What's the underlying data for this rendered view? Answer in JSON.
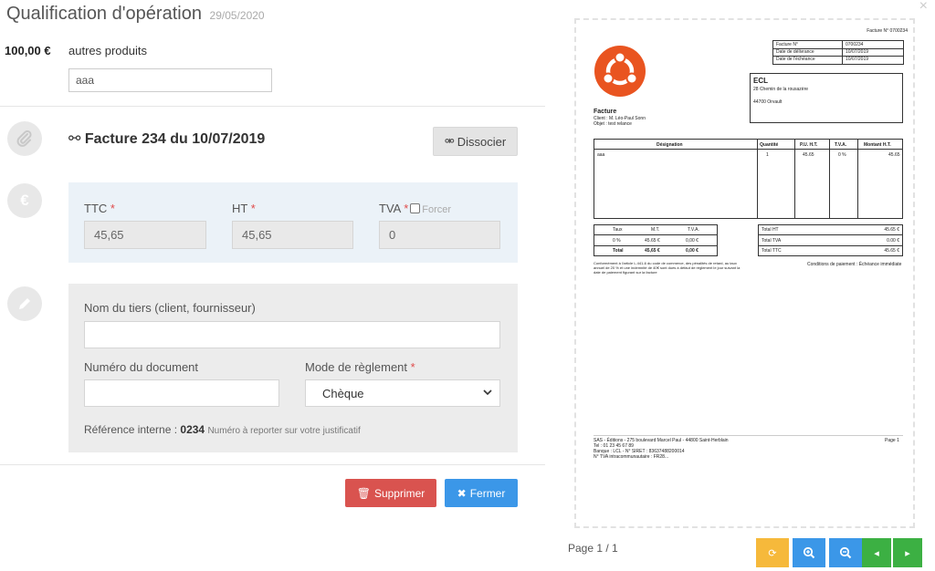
{
  "modal": {
    "title": "Qualification d'opération",
    "date": "29/05/2020",
    "close_symbol": "×"
  },
  "operation": {
    "amount": "100,00 €",
    "product_label": "autres produits",
    "description_value": "aaa"
  },
  "facture": {
    "title": "Facture 234 du 10/07/2019",
    "dissocier_label": "Dissocier"
  },
  "amounts": {
    "ttc_label": "TTC",
    "ht_label": "HT",
    "tva_label": "TVA",
    "required_mark": "*",
    "forcer_label": "Forcer",
    "ttc_value": "45,65",
    "ht_value": "45,65",
    "tva_value": "0"
  },
  "tiers": {
    "name_label": "Nom du tiers (client, fournisseur)",
    "name_value": "",
    "doc_number_label": "Numéro du document",
    "doc_number_value": "",
    "payment_label": "Mode de règlement",
    "payment_selected": "Chèque",
    "ref_label": "Référence interne :",
    "ref_value": "0234",
    "ref_hint": "Numéro à reporter sur votre justificatif"
  },
  "actions": {
    "delete_label": "Supprimer",
    "close_label": "Fermer"
  },
  "preview": {
    "header_small": "Facture N° 0700234",
    "meta_rows": [
      {
        "k": "Facture N°",
        "v": "0700234"
      },
      {
        "k": "Date de délivrance",
        "v": "10/07/2019"
      },
      {
        "k": "Date de l'échéance",
        "v": "10/07/2019"
      }
    ],
    "client_name": "ECL",
    "client_addr1": "28 Chemin de la rousazère",
    "client_addr2": "44700 Orvault",
    "doc_type": "Facture",
    "client_line": "Client : M. Léo-Paul Sonn",
    "object_line": "Objet : test relance",
    "table_headers": [
      "Désignation",
      "Quantité",
      "P.U. H.T.",
      "T.V.A.",
      "Montant H.T."
    ],
    "table_row": [
      "aaa",
      "1",
      "45.65",
      "0 %",
      "45.65"
    ],
    "tax_headers": [
      "Taux",
      "M.T.",
      "T.V.A."
    ],
    "tax_row": [
      "0 %",
      "45.65 €",
      "0,00 €"
    ],
    "tax_total": [
      "Total",
      "45,65 €",
      "0,00 €"
    ],
    "totals": [
      {
        "k": "Total HT",
        "v": "45.65 €"
      },
      {
        "k": "Total TVA",
        "v": "0.00 €"
      },
      {
        "k": "Total TTC",
        "v": "45.65 €"
      }
    ],
    "legal_text": "Conformément à l'article L.441-6 du code de commerce, des pénalités de retard, au taux annuel de 20 % et une indemnité de 40€ sont dues à défaut de règlement le jour suivant la date de paiement figurant sur la facture",
    "payment_conditions": "Conditions de paiement : Échéance immédiate",
    "footer_line1": "SAS - Éditions - 275 boulevard Marcel Paul - 44800 Saint-Herblain",
    "footer_line2": "Tel : 01 23 45 67 89",
    "footer_line3": "Banque : LCL - N° SIRET : 83637488200014",
    "footer_line4": "N° TVA intracommunautaire : FR28...",
    "footer_page": "Page 1",
    "page_indicator": "Page 1 / 1"
  },
  "colors": {
    "danger": "#d9534f",
    "primary": "#3b97e8",
    "warning": "#f6b93b",
    "info": "#4a90e2",
    "success": "#3cb043",
    "logo": "#e95420"
  },
  "icons": {
    "facture": "paperclip-icon",
    "amounts": "euro-icon",
    "tiers": "pencil-icon"
  }
}
